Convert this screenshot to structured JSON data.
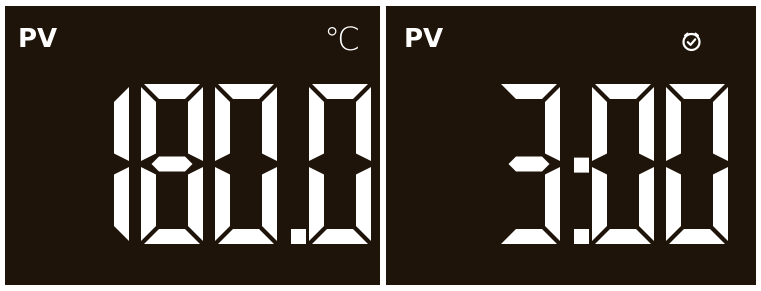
{
  "colors": {
    "background": "#1f140a",
    "segment": "#ffffff"
  },
  "left_display": {
    "label": "PV",
    "unit": "℃",
    "value": "180.0"
  },
  "right_display": {
    "label": "PV",
    "icon": "clock-icon",
    "value": "3:00"
  }
}
